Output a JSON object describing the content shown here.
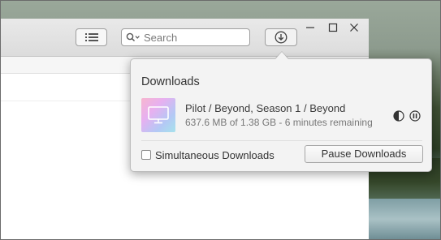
{
  "toolbar": {
    "search_placeholder": "Search",
    "list_icon": "list-icon",
    "download_icon": "download-icon"
  },
  "window_controls": {
    "minimize": "minimize-icon",
    "maximize": "maximize-icon",
    "close": "close-icon"
  },
  "downloads": {
    "title": "Downloads",
    "items": [
      {
        "title": "Pilot / Beyond, Season 1 / Beyond",
        "progress_text": "637.6 MB of 1.38 GB - 6 minutes remaining",
        "thumbnail_icon": "tv-icon"
      }
    ],
    "simultaneous_label": "Simultaneous Downloads",
    "simultaneous_checked": false,
    "pause_label": "Pause Downloads"
  },
  "colors": {
    "window_bg": "#ffffff",
    "titlebar_bg": "#dcdcdc",
    "popover_bg": "#f3f3f3",
    "text_primary": "#333333",
    "text_secondary": "#777777"
  }
}
